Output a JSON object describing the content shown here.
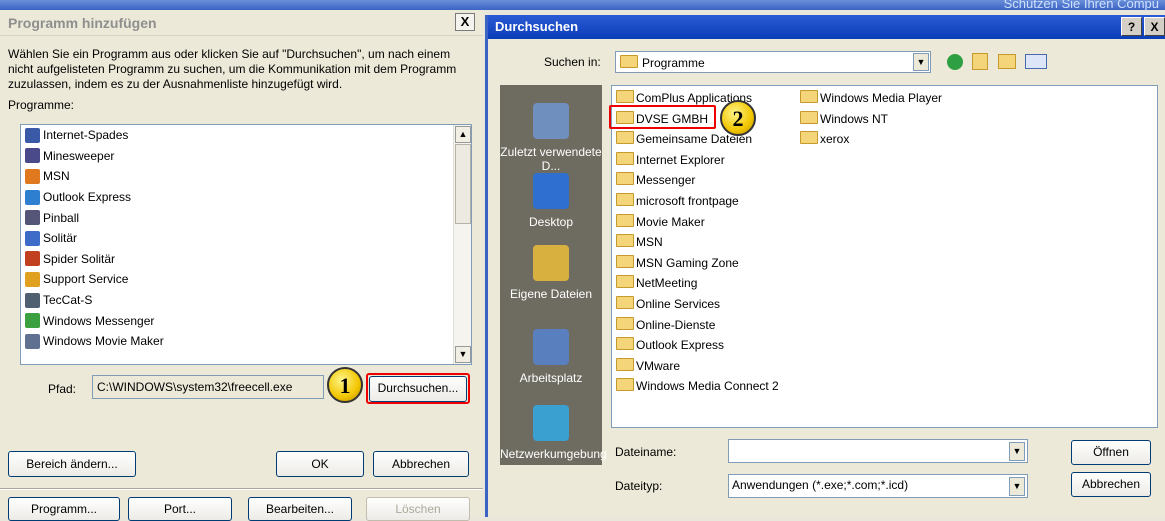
{
  "background": {
    "corner_text": "Schützen Sie Ihren Compu"
  },
  "left_dialog": {
    "title": "Programm hinzufügen",
    "close_label": "X",
    "description": "Wählen Sie ein Programm aus oder klicken Sie auf \"Durchsuchen\", um nach einem nicht aufgelisteten Programm zu suchen, um die Kommunikation mit dem Programm zuzulassen, indem es zu der Ausnahmenliste hinzugefügt wird.",
    "programs_label": "Programme:",
    "programs": [
      {
        "label": "Internet-Spades",
        "icon": "spades-icon",
        "color": "#3a5aa8"
      },
      {
        "label": "Minesweeper",
        "icon": "mine-icon",
        "color": "#4a4a8a"
      },
      {
        "label": "MSN",
        "icon": "msn-butterfly-icon",
        "color": "#e07820"
      },
      {
        "label": "Outlook Express",
        "icon": "outlook-express-icon",
        "color": "#2f7fd0"
      },
      {
        "label": "Pinball",
        "icon": "pinball-icon",
        "color": "#555577"
      },
      {
        "label": "Solitär",
        "icon": "solitaire-icon",
        "color": "#3d6cc8"
      },
      {
        "label": "Spider Solitär",
        "icon": "spider-solitaire-icon",
        "color": "#c04020"
      },
      {
        "label": "Support Service",
        "icon": "support-service-icon",
        "color": "#e0a020"
      },
      {
        "label": "TecCat-S",
        "icon": "teccat-icon",
        "color": "#506070"
      },
      {
        "label": "Windows Messenger",
        "icon": "messenger-icon",
        "color": "#3aa040"
      },
      {
        "label": "Windows Movie Maker",
        "icon": "movie-maker-icon",
        "color": "#607090"
      }
    ],
    "path_label": "Pfad:",
    "path_value": "C:\\WINDOWS\\system32\\freecell.exe",
    "browse_label": "Durchsuchen...",
    "step1": "1",
    "change_scope_label": "Bereich ändern...",
    "ok_label": "OK",
    "cancel_label": "Abbrechen",
    "bottom_buttons": [
      "Programm...",
      "Port...",
      "Bearbeiten...",
      "Löschen"
    ]
  },
  "right_dialog": {
    "title": "Durchsuchen",
    "help_label": "?",
    "close_label": "X",
    "look_in_label": "Suchen in:",
    "look_in_value": "Programme",
    "places": [
      {
        "label": "Zuletzt verwendete D...",
        "icon": "recent-documents-icon"
      },
      {
        "label": "Desktop",
        "icon": "desktop-icon"
      },
      {
        "label": "Eigene Dateien",
        "icon": "my-documents-icon"
      },
      {
        "label": "Arbeitsplatz",
        "icon": "my-computer-icon"
      },
      {
        "label": "Netzwerkumgebung",
        "icon": "network-icon"
      }
    ],
    "folders_col1": [
      "ComPlus Applications",
      "DVSE GMBH",
      "Gemeinsame Dateien",
      "Internet Explorer",
      "Messenger",
      "microsoft frontpage",
      "Movie Maker",
      "MSN",
      "MSN Gaming Zone",
      "NetMeeting",
      "Online Services",
      "Online-Dienste",
      "Outlook Express",
      "VMware",
      "Windows Media Connect 2"
    ],
    "folders_col2": [
      "Windows Media Player",
      "Windows NT",
      "xerox"
    ],
    "step2": "2",
    "filename_label": "Dateiname:",
    "filename_value": "",
    "filetype_label": "Dateityp:",
    "filetype_value": "Anwendungen (*.exe;*.com;*.icd)",
    "open_label": "Öffnen",
    "cancel_label": "Abbrechen"
  }
}
